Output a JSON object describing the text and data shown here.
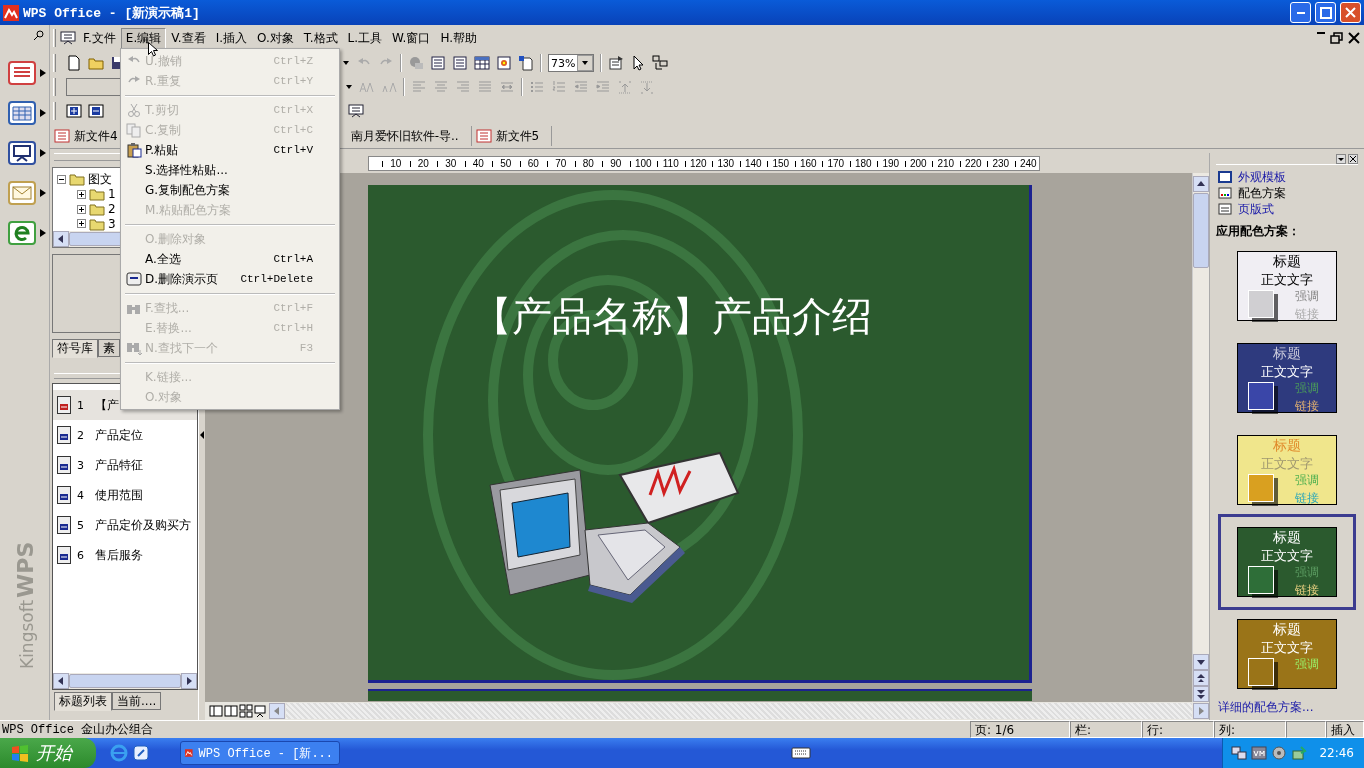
{
  "window": {
    "title": "WPS Office - [新演示稿1]"
  },
  "launcher": {
    "logo_brand": "Kingsoft",
    "logo_product": "WPS"
  },
  "menubar": [
    {
      "label": "F.文件",
      "open": false
    },
    {
      "label": "E.编辑",
      "open": true
    },
    {
      "label": "V.查看",
      "open": false
    },
    {
      "label": "I.插入",
      "open": false
    },
    {
      "label": "O.对象",
      "open": false
    },
    {
      "label": "T.格式",
      "open": false
    },
    {
      "label": "L.工具",
      "open": false
    },
    {
      "label": "W.窗口",
      "open": false
    },
    {
      "label": "H.帮助",
      "open": false
    }
  ],
  "toolbar": {
    "zoom": "73%"
  },
  "edit_menu": {
    "groups": [
      [
        {
          "label": "U.撤销",
          "shortcut": "Ctrl+Z",
          "disabled": true
        },
        {
          "label": "R.重复",
          "shortcut": "Ctrl+Y",
          "disabled": true
        }
      ],
      [
        {
          "label": "T.剪切",
          "shortcut": "Ctrl+X",
          "disabled": true
        },
        {
          "label": "C.复制",
          "shortcut": "Ctrl+C",
          "disabled": true
        },
        {
          "label": "P.粘贴",
          "shortcut": "Ctrl+V",
          "disabled": false
        },
        {
          "label": "S.选择性粘贴...",
          "disabled": false
        },
        {
          "label": "G.复制配色方案",
          "disabled": false
        },
        {
          "label": "M.粘贴配色方案",
          "disabled": true
        }
      ],
      [
        {
          "label": "O.删除对象",
          "disabled": true
        },
        {
          "label": "A.全选",
          "shortcut": "Ctrl+A",
          "disabled": false
        },
        {
          "label": "D.删除演示页",
          "shortcut": "Ctrl+Delete",
          "disabled": false
        }
      ],
      [
        {
          "label": "F.查找...",
          "shortcut": "Ctrl+F",
          "disabled": true
        },
        {
          "label": "E.替换...",
          "shortcut": "Ctrl+H",
          "disabled": true
        },
        {
          "label": "N.查找下一个",
          "shortcut": "F3",
          "disabled": true
        }
      ],
      [
        {
          "label": "K.链接...",
          "disabled": true
        },
        {
          "label": "O.对象",
          "disabled": true
        }
      ]
    ]
  },
  "document_tabs": [
    {
      "label": "新文件4"
    },
    {
      "label": "南月爱怀旧软件-导.."
    },
    {
      "label": "新文件5"
    }
  ],
  "left_panel": {
    "tree": [
      {
        "label": "图文",
        "expanded": true,
        "children": [
          {
            "label": "1",
            "expanded": false
          },
          {
            "label": "2",
            "expanded": false
          },
          {
            "label": "3",
            "expanded": false
          }
        ]
      }
    ],
    "library_tabs": [
      {
        "label": "符号库",
        "selected": true
      },
      {
        "label": "素",
        "selected": false
      }
    ],
    "slides": [
      {
        "number": "1",
        "title": "【产",
        "selected": true
      },
      {
        "number": "2",
        "title": "产品定位",
        "selected": false
      },
      {
        "number": "3",
        "title": "产品特征",
        "selected": false
      },
      {
        "number": "4",
        "title": "使用范围",
        "selected": false
      },
      {
        "number": "5",
        "title": "产品定价及购买方",
        "selected": false
      },
      {
        "number": "6",
        "title": "售后服务",
        "selected": false
      }
    ],
    "bottom_tabs": [
      {
        "label": "标题列表",
        "selected": true
      },
      {
        "label": "当前....",
        "selected": false
      }
    ]
  },
  "ruler": [
    "10",
    "20",
    "30",
    "40",
    "50",
    "60",
    "70",
    "80",
    "90",
    "100",
    "110",
    "120",
    "130",
    "140",
    "150",
    "160",
    "170",
    "180",
    "190",
    "200",
    "210",
    "220",
    "230",
    "240"
  ],
  "slide": {
    "title": "【产品名称】产品介绍"
  },
  "task_pane": {
    "links": [
      {
        "label": "外观模板",
        "selected": false
      },
      {
        "label": "配色方案",
        "selected": true
      },
      {
        "label": "页版式",
        "selected": false
      }
    ],
    "heading": "应用配色方案：",
    "schemes": [
      {
        "color": "#f0eef3",
        "selected": false,
        "title": {
          "text": "标题",
          "color": "#000000"
        },
        "body": {
          "text": "正文文字",
          "color": "#000000"
        },
        "accent": {
          "text": "强调",
          "color": "#888888"
        },
        "link": {
          "text": "链接",
          "color": "#aaaaaa"
        },
        "fill": {
          "color": "#d0cfd2"
        }
      },
      {
        "color": "#2e3a7e",
        "selected": false,
        "title": {
          "text": "标题",
          "color": "#ccccdd"
        },
        "body": {
          "text": "正文文字",
          "color": "#ffffff"
        },
        "accent": {
          "text": "强调",
          "color": "#4a9a5a"
        },
        "link": {
          "text": "链接",
          "color": "#e0b070"
        },
        "fill": {
          "color": "#3a46a8"
        }
      },
      {
        "color": "#f0e68c",
        "selected": false,
        "title": {
          "text": "标题",
          "color": "#e08a2a"
        },
        "body": {
          "text": "正文文字",
          "color": "#a09870"
        },
        "accent": {
          "text": "强调",
          "color": "#50b050"
        },
        "link": {
          "text": "链接",
          "color": "#30a8b8"
        },
        "fill": {
          "color": "#d9a020"
        }
      },
      {
        "color": "#2b5a2e",
        "selected": true,
        "title": {
          "text": "标题",
          "color": "#ffffff"
        },
        "body": {
          "text": "正文文字",
          "color": "#ffffff"
        },
        "accent": {
          "text": "强调",
          "color": "#5a9a60"
        },
        "link": {
          "text": "链接",
          "color": "#e8d080"
        },
        "fill": {
          "color": "#2e6e38"
        }
      },
      {
        "color": "#9a7418",
        "selected": false,
        "title": {
          "text": "标题",
          "color": "#ffffff"
        },
        "body": {
          "text": "正文文字",
          "color": "#ffffff"
        },
        "accent": {
          "text": "强调",
          "color": "#99ee66"
        },
        "fill": {
          "color": "#9a7418"
        }
      }
    ],
    "more_link": "详细的配色方案..."
  },
  "status_bar": {
    "message": "WPS Office 金山办公组合",
    "cells": [
      "页: 1/6",
      "栏:",
      "行:",
      "列:"
    ],
    "mode": "插入"
  },
  "taskbar": {
    "start": "开始",
    "tasks": [
      {
        "label": "WPS Office - [新..."
      }
    ],
    "clock": "22:46"
  }
}
